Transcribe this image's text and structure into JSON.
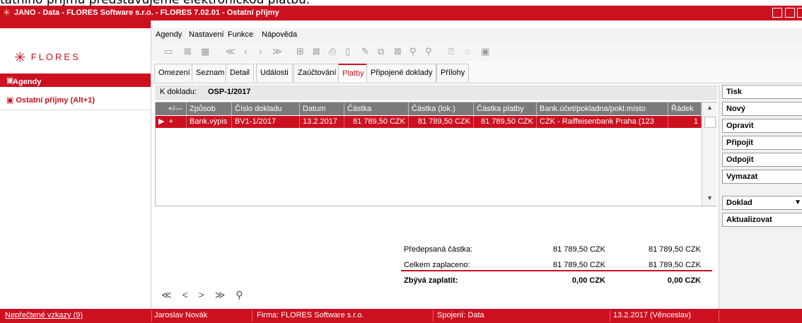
{
  "caption_fragment": "tatního příjmu představujeme elektronickou platbu.",
  "titlebar": {
    "title": "JANO - Data - FLORES Software  s.r.o. - FLORES 7.02.01 - Ostatní příjmy",
    "logo_icon": "flores-star-icon"
  },
  "brand": {
    "logo_text": "FLORES",
    "accent": "#cc1020"
  },
  "sidebar": {
    "items": [
      {
        "label": "Agendy"
      },
      {
        "label": "Ostatní příjmy (Alt+1)"
      }
    ]
  },
  "menu": {
    "items": [
      "Agendy",
      "Nastavení",
      "Funkce",
      "Nápověda"
    ]
  },
  "toolbar": {
    "icons": [
      "open-icon",
      "close-icon",
      "grid-icon",
      "first-icon",
      "prev-icon",
      "next-icon",
      "last-icon",
      "table-icon",
      "delete-icon",
      "print-icon",
      "new-icon",
      "edit-icon",
      "copy-icon",
      "delete-doc-icon",
      "search-icon",
      "search-plus-icon",
      "info-icon",
      "comment-icon",
      "note-icon"
    ]
  },
  "tabs": [
    {
      "label": "Omezení"
    },
    {
      "label": "Seznam"
    },
    {
      "label": "Detail"
    },
    {
      "label": "Události"
    },
    {
      "label": "Zaúčtování"
    },
    {
      "label": "Platby"
    },
    {
      "label": "Připojené doklady"
    },
    {
      "label": "Přílohy"
    }
  ],
  "doc": {
    "label": "K dokladu:",
    "value": "OSP-1/2017"
  },
  "grid": {
    "columns": [
      "+/—",
      "Způsob",
      "Číslo dokladu",
      "Datum",
      "Částka",
      "Částka (lok.)",
      "Částka platby",
      "Bank.účet/pokladna/pokl.místo",
      "Řádek"
    ],
    "rows": [
      {
        "sign": "+",
        "method": "Bank.výpis",
        "doc": "BV1-1/2017",
        "date": "13.2.2017",
        "amount": "81 789,50 CZK",
        "amount_local": "81 789,50 CZK",
        "payment": "81 789,50 CZK",
        "account": "CZK - Raiffeisenbank Praha (123",
        "row": "1"
      }
    ]
  },
  "summary": {
    "rows": [
      {
        "label": "Předepsaná částka:",
        "v1": "81 789,50 CZK",
        "v2": "81 789,50 CZK"
      },
      {
        "label": "Celkem zaplaceno:",
        "v1": "81 789,50 CZK",
        "v2": "81 789,50 CZK"
      },
      {
        "label": "Zbývá zaplatit:",
        "v1": "0,00 CZK",
        "v2": "0,00 CZK"
      }
    ]
  },
  "pager": {
    "first": "≪",
    "prev": "<",
    "next": ">",
    "last": "≫",
    "search": "⚲"
  },
  "actions": {
    "items": [
      "Tisk",
      "Nový",
      "Opravit",
      "Připojit",
      "Odpojit",
      "Vymazat"
    ],
    "doklad": "Doklad",
    "aktualizovat": "Aktualizovat"
  },
  "status": {
    "messages": "Nepřečtené vzkazy (9)",
    "user": "Jaroslav Novák",
    "firm": "Firma: FLORES Software  s.r.o.",
    "connection": "Spojení: Data",
    "date": "13.2.2017 (Věnceslav)"
  }
}
